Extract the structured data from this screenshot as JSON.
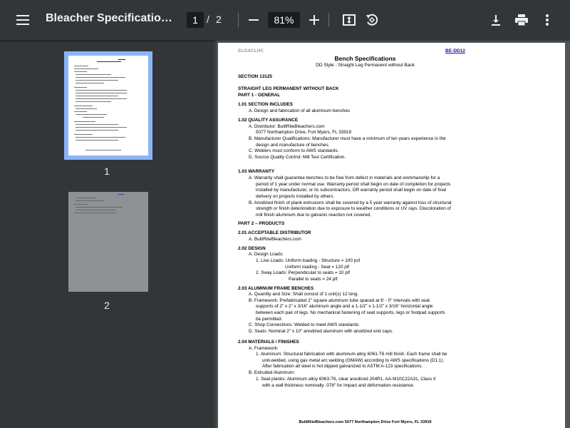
{
  "toolbar": {
    "title": "Bleacher Specifications for...",
    "current_page": "1",
    "page_separator": "/",
    "total_pages": "2",
    "zoom": "81%",
    "colors": {
      "bg": "#323639",
      "text": "#f1f1f1",
      "selected_thumb": "#8ab4f8"
    },
    "icons": [
      "menu-icon",
      "zoom-out-icon",
      "zoom-in-icon",
      "fit-page-icon",
      "rotate-icon",
      "download-icon",
      "print-icon",
      "more-vert-icon"
    ]
  },
  "sidebar": {
    "thumbnails": [
      {
        "label": "1",
        "selected": true
      },
      {
        "label": "2",
        "selected": false
      }
    ]
  },
  "page": {
    "header_left": "ELGACLHC",
    "header_right": "BE-DD12",
    "title": "Bench Specifications",
    "subtitle": "DD Style - Straight Leg Permanent without Back",
    "lines": [
      {
        "text": "SECTION 13125",
        "bold": true,
        "indent": 0
      },
      {
        "text": "STRAIGHT LEG PERMANENT WITHOUT BACK",
        "bold": true,
        "indent": 0
      },
      {
        "text": "PART 1 - GENERAL",
        "bold": true,
        "indent": 0
      },
      {
        "text": "1.01 SECTION INCLUDES",
        "bold": true,
        "indent": 0
      },
      {
        "text": "A. Design and fabrication of all aluminum benches",
        "bold": false,
        "indent": 1
      },
      {
        "text": "1.02 QUALITY ASSURANCE",
        "bold": true,
        "indent": 0
      },
      {
        "text": "A. Distributor: BuiltRiteBleachers.com",
        "bold": false,
        "indent": 1
      },
      {
        "text": "5077 Northampton Drive, Fort Myers, FL 33919",
        "bold": false,
        "indent": 2
      },
      {
        "text": "B. Manufacturer Qualifications: Manufacturer must have a minimum of ten years experience in the",
        "bold": false,
        "indent": 1
      },
      {
        "text": "design and manufacture of benches.",
        "bold": false,
        "indent": 2
      },
      {
        "text": "C. Welders must conform to AWS standards.",
        "bold": false,
        "indent": 1
      },
      {
        "text": "D. Source Quality Control: Mill Test Certification.",
        "bold": false,
        "indent": 1
      },
      {
        "text": "1.03 WARRANTY",
        "bold": true,
        "indent": 0
      },
      {
        "text": "A. Warranty shall guarantee benches to be free from defect in materials and workmanship for a",
        "bold": false,
        "indent": 1
      },
      {
        "text": "period of 1 year under normal use. Warranty period shall begin on date of completion for projects",
        "bold": false,
        "indent": 2
      },
      {
        "text": "installed by manufacturer, or its subcontractors, OR warranty period shall begin on date of final",
        "bold": false,
        "indent": 2
      },
      {
        "text": "delivery on projects installed by others.",
        "bold": false,
        "indent": 2
      },
      {
        "text": "B. Anodized finish of plank extrusions shall be covered by a 5 year warranty against loss of structural",
        "bold": false,
        "indent": 1
      },
      {
        "text": "strength or finish deterioration due to exposure to weather conditions or UV rays. Discoloration of",
        "bold": false,
        "indent": 2
      },
      {
        "text": "mill finish aluminum due to galvanic reaction not covered.",
        "bold": false,
        "indent": 2
      },
      {
        "text": "PART 2 – PRODUCTS",
        "bold": true,
        "indent": 0
      },
      {
        "text": "2.01 ACCEPTABLE DISTRIBUTOR",
        "bold": true,
        "indent": 0
      },
      {
        "text": "A. BuiltRiteBleachers.com",
        "bold": false,
        "indent": 1
      },
      {
        "text": "2.02 DESIGN",
        "bold": true,
        "indent": 0
      },
      {
        "text": "A. Design Loads:",
        "bold": false,
        "indent": 1
      },
      {
        "text": "1. Live Loads: Uniform loading - Structure = 100 psf",
        "bold": false,
        "indent": 2
      },
      {
        "text": "Uniform loading - Seat = 120 plf",
        "bold": false,
        "indent": 4
      },
      {
        "text": "2. Sway Loads: Perpendicular to seats = 10 plf",
        "bold": false,
        "indent": 2
      },
      {
        "text": "Parallel to seats = 24 plf",
        "bold": false,
        "indent": 5
      },
      {
        "text": "2.03 ALUMINUM FRAME BENCHES",
        "bold": true,
        "indent": 0
      },
      {
        "text": "A. Quantity and Size: Shall consist of 1 unit(s) 12 long.",
        "bold": false,
        "indent": 1
      },
      {
        "text": "B. Framework: Prefabricated 2\" square aluminum tube spaced at 6' - 0\" intervals with seat",
        "bold": false,
        "indent": 1
      },
      {
        "text": "supports of 2\" x 2\" x 3/16\" aluminum angle and a 1-1/2\" x 1-1/2\" x 3/16\" horizontal angle",
        "bold": false,
        "indent": 2
      },
      {
        "text": "between each pair of legs. No mechanical fastening of seat supports, legs or footpad supports",
        "bold": false,
        "indent": 2
      },
      {
        "text": "be permitted.",
        "bold": false,
        "indent": 2
      },
      {
        "text": "C. Shop Connections: Welded to meet AWS standards.",
        "bold": false,
        "indent": 1
      },
      {
        "text": "D. Seats: Nominal 2\" x 10\" anodized aluminum with anodized end caps.",
        "bold": false,
        "indent": 1
      },
      {
        "text": "2.04 MATERIALS / FINISHES",
        "bold": true,
        "indent": 0
      },
      {
        "text": "A. Framework:",
        "bold": false,
        "indent": 1
      },
      {
        "text": "1. Aluminum: Structural fabrication with aluminum alloy 6061-T6 mill finish. Each frame shall be",
        "bold": false,
        "indent": 2
      },
      {
        "text": "unit-welded, using gas metal arc welding (GMAW) according to AWS specifications (D1.1).",
        "bold": false,
        "indent": 3
      },
      {
        "text": "After fabrication all steel is hot dipped galvanized to ASTM A-123 specifications.",
        "bold": false,
        "indent": 3
      },
      {
        "text": "B. Extruded Aluminum:",
        "bold": false,
        "indent": 1
      },
      {
        "text": "1. Seat planks: Aluminum alloy 6063-T6, clear anodized 204R1, AA-M10C22A31, Class II",
        "bold": false,
        "indent": 2
      },
      {
        "text": "with a wall thickness nominally .078\" for impact and deformation resistance.",
        "bold": false,
        "indent": 3
      }
    ],
    "footer": "BuiltRiteBleachers.com 5077 Northampton Drive Fort Myers, FL 33919"
  }
}
